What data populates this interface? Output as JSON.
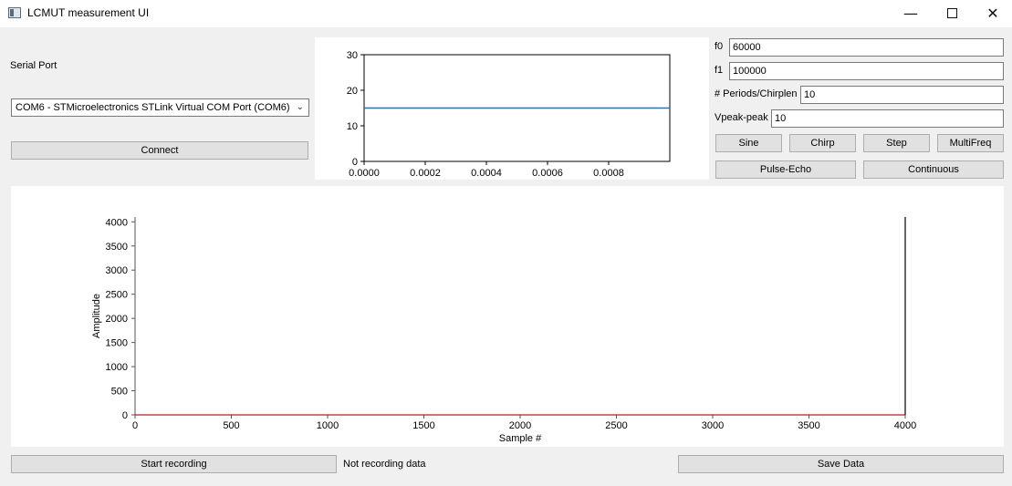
{
  "window": {
    "title": "LCMUT measurement UI",
    "minimize_glyph": "—",
    "close_glyph": "✕"
  },
  "serial": {
    "label": "Serial Port",
    "selected_port": "COM6 - STMicroelectronics STLink Virtual COM Port (COM6)",
    "connect_label": "Connect"
  },
  "params": {
    "f0": {
      "label": "f0",
      "value": "60000"
    },
    "f1": {
      "label": "f1",
      "value": "100000"
    },
    "periods": {
      "label": "# Periods/Chirplen",
      "value": "10"
    },
    "vpeak": {
      "label": "Vpeak-peak",
      "value": "10"
    }
  },
  "waveform_buttons": {
    "sine": "Sine",
    "chirp": "Chirp",
    "step": "Step",
    "multifreq": "MultiFreq"
  },
  "mode_buttons": {
    "pulse_echo": "Pulse-Echo",
    "continuous": "Continuous"
  },
  "footer": {
    "start_recording": "Start recording",
    "status": "Not recording data",
    "save_data": "Save Data"
  },
  "chart_data": [
    {
      "type": "line",
      "title": "",
      "xlabel": "",
      "ylabel": "",
      "xlim": [
        0,
        0.001
      ],
      "ylim": [
        0,
        30
      ],
      "x_ticks": [
        "0.0000",
        "0.0002",
        "0.0004",
        "0.0006",
        "0.0008"
      ],
      "y_ticks": [
        "0",
        "10",
        "20",
        "30"
      ],
      "series": [
        {
          "x": [
            0,
            0.001
          ],
          "y": [
            15,
            15
          ],
          "color": "#1f77b4"
        }
      ]
    },
    {
      "type": "line",
      "title": "",
      "xlabel": "Sample #",
      "ylabel": "Amplitude",
      "xlim": [
        0,
        4000
      ],
      "ylim": [
        0,
        4100
      ],
      "x_ticks": [
        "0",
        "500",
        "1000",
        "1500",
        "2000",
        "2500",
        "3000",
        "3500",
        "4000"
      ],
      "y_ticks": [
        "0",
        "500",
        "1000",
        "1500",
        "2000",
        "2500",
        "3000",
        "3500",
        "4000"
      ],
      "series": [
        {
          "x": [
            0,
            4000
          ],
          "y": [
            0,
            0
          ],
          "color": "#b22222"
        },
        {
          "x": [
            4000,
            4000
          ],
          "y": [
            0,
            4100
          ],
          "color": "#000000"
        }
      ]
    }
  ]
}
